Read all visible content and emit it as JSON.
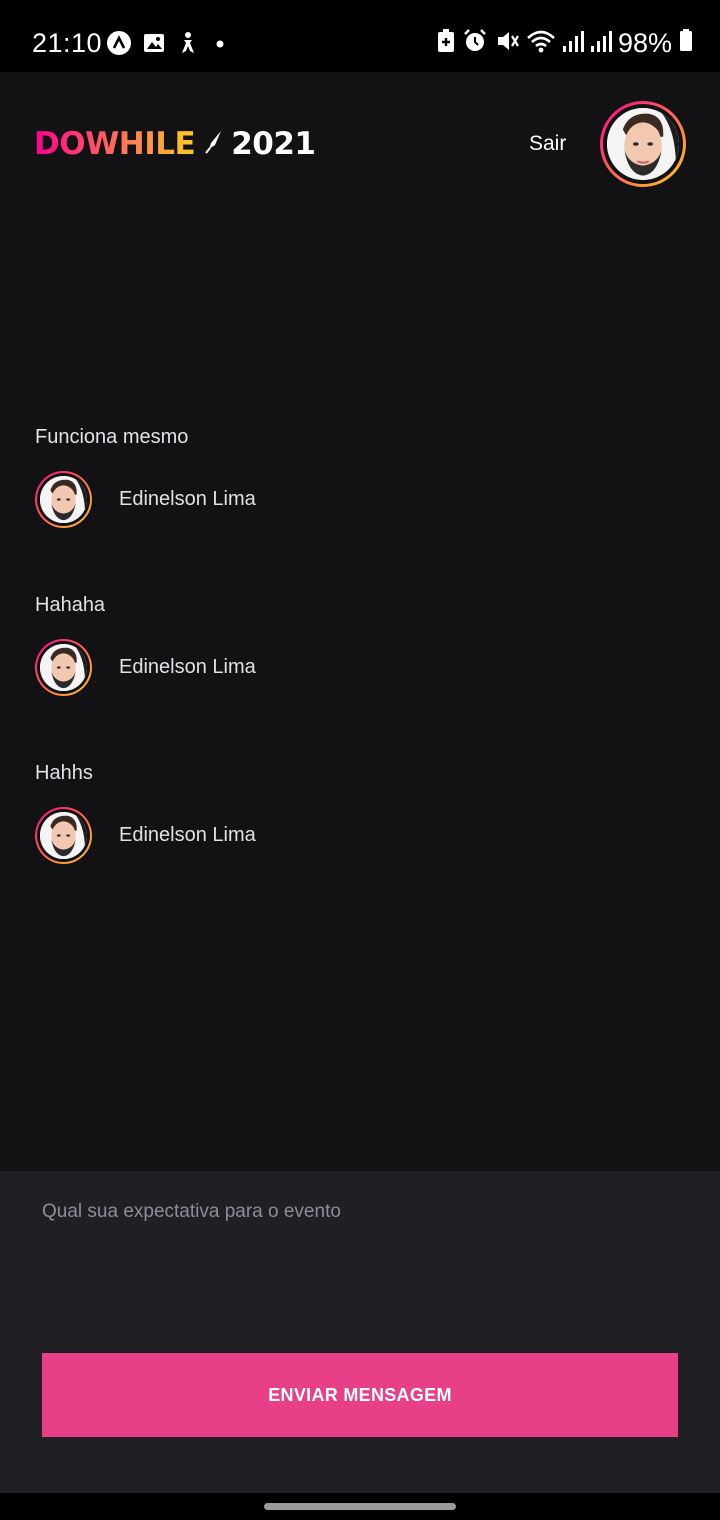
{
  "status_bar": {
    "time": "21:10",
    "battery_percent": "98%",
    "left_icons": [
      "app-notification-icon",
      "gallery-icon",
      "accessibility-icon",
      "dot-icon"
    ],
    "right_icons": [
      "battery-saver-icon",
      "alarm-icon",
      "mute-icon",
      "wifi-icon",
      "signal-icon",
      "signal-icon",
      "battery-icon"
    ]
  },
  "header": {
    "logo_dowhile": "DOWHILE",
    "logo_year": "2021",
    "signout_label": "Sair"
  },
  "messages": [
    {
      "text": "Funciona mesmo",
      "user": "Edinelson Lima"
    },
    {
      "text": "Hahaha",
      "user": "Edinelson Lima"
    },
    {
      "text": "Hahhs",
      "user": "Edinelson Lima"
    }
  ],
  "form": {
    "placeholder": "Qual sua expectativa para o evento",
    "value": "",
    "send_label": "ENVIAR MENSAGEM"
  },
  "colors": {
    "background": "#121214",
    "form_background": "#202024",
    "button": "#e83f89",
    "gradient_start": "#ff008e",
    "gradient_end": "#ffcd1e"
  }
}
